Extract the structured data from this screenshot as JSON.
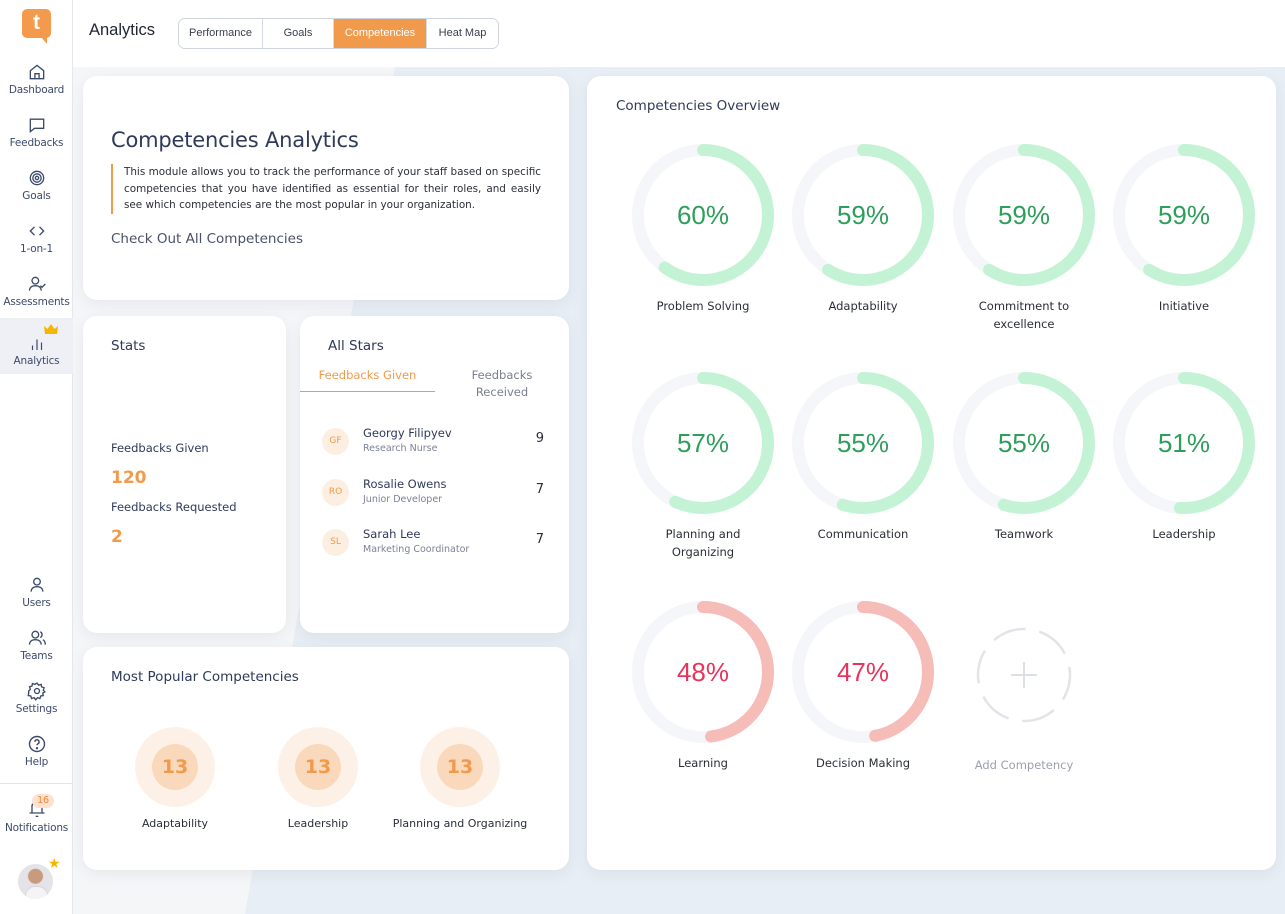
{
  "app": {
    "logo_letter": "t"
  },
  "sidebar": {
    "top_items": [
      {
        "label": "Dashboard",
        "icon": "home-icon"
      },
      {
        "label": "Feedbacks",
        "icon": "chat-bubble-icon"
      },
      {
        "label": "Goals",
        "icon": "target-icon"
      },
      {
        "label": "1-on-1",
        "icon": "code-brackets-icon"
      },
      {
        "label": "Assessments",
        "icon": "user-check-icon"
      },
      {
        "label": "Analytics",
        "icon": "bar-chart-icon",
        "active": true,
        "premium": true
      }
    ],
    "bottom_items": [
      {
        "label": "Users",
        "icon": "user-icon"
      },
      {
        "label": "Teams",
        "icon": "users-icon"
      },
      {
        "label": "Settings",
        "icon": "gear-icon"
      },
      {
        "label": "Help",
        "icon": "help-circle-icon"
      }
    ],
    "notifications": {
      "label": "Notifications",
      "count": "16"
    }
  },
  "header": {
    "title": "Analytics",
    "tabs": [
      {
        "label": "Performance",
        "active": false
      },
      {
        "label": "Goals",
        "active": false
      },
      {
        "label": "Competencies",
        "active": true
      },
      {
        "label": "Heat Map",
        "active": false
      }
    ]
  },
  "intro": {
    "title": "Competencies Analytics",
    "description": "This module allows you to track the performance of your staff based on specific competencies that you have identified as essential for their roles, and easily see which competencies are the most popular in your organization.",
    "link": "Check Out All Competencies"
  },
  "stats": {
    "title": "Stats",
    "feedbacks_given_label": "Feedbacks Given",
    "feedbacks_given_value": "120",
    "feedbacks_requested_label": "Feedbacks Requested",
    "feedbacks_requested_value": "2"
  },
  "all_stars": {
    "title": "All Stars",
    "tabs": [
      "Feedbacks Given",
      "Feedbacks Received"
    ],
    "active_tab": 0,
    "people": [
      {
        "initials": "GF",
        "name": "Georgy Filipyev",
        "role": "Research Nurse",
        "count": "9"
      },
      {
        "initials": "RO",
        "name": "Rosalie Owens",
        "role": "Junior Developer",
        "count": "7"
      },
      {
        "initials": "SL",
        "name": "Sarah Lee",
        "role": "Marketing Coordinator",
        "count": "7"
      }
    ]
  },
  "popular": {
    "title": "Most Popular Competencies",
    "items": [
      {
        "count": "13",
        "label": "Adaptability"
      },
      {
        "count": "13",
        "label": "Leadership"
      },
      {
        "count": "13",
        "label": "Planning and Organizing"
      }
    ]
  },
  "overview": {
    "title": "Competencies Overview",
    "colors": {
      "good_arc": "#c3f3d4",
      "good_text": "#2e9e5b",
      "bad_arc": "#f5bcb8",
      "bad_text": "#e8345c",
      "track": "#f5f6f9"
    },
    "competencies": [
      {
        "label": "Problem Solving",
        "percent": 60,
        "display": "60%"
      },
      {
        "label": "Adaptability",
        "percent": 59,
        "display": "59%"
      },
      {
        "label": "Commitment to excellence",
        "percent": 59,
        "display": "59%"
      },
      {
        "label": "Initiative",
        "percent": 59,
        "display": "59%"
      },
      {
        "label": "Planning and Organizing",
        "percent": 57,
        "display": "57%"
      },
      {
        "label": "Communication",
        "percent": 55,
        "display": "55%"
      },
      {
        "label": "Teamwork",
        "percent": 55,
        "display": "55%"
      },
      {
        "label": "Leadership",
        "percent": 51,
        "display": "51%"
      },
      {
        "label": "Learning",
        "percent": 48,
        "display": "48%"
      },
      {
        "label": "Decision Making",
        "percent": 47,
        "display": "47%"
      }
    ],
    "add_label": "Add Competency"
  }
}
